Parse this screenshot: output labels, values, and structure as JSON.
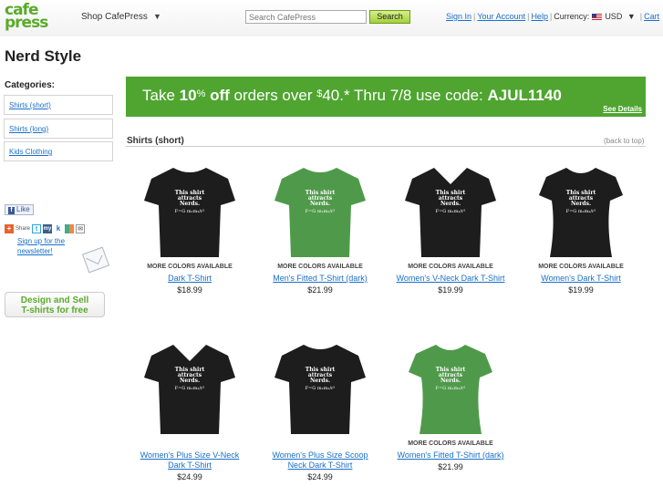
{
  "header": {
    "logo_line1": "cafe",
    "logo_line2": "press",
    "shop_label": "Shop CafePress",
    "search_placeholder": "Search CafePress",
    "search_button": "Search",
    "sign_in": "Sign In",
    "account": "Your Account",
    "help": "Help",
    "currency_label": "Currency:",
    "currency_value": "USD",
    "cart": "Cart"
  },
  "page_title": "Nerd Style",
  "sidebar": {
    "categories_title": "Categories:",
    "categories": [
      "Shirts (short)",
      "Shirts (long)",
      "Kids Clothing"
    ],
    "like": "Like",
    "share": "Share",
    "newsletter": "Sign up for the newsletter!",
    "design_line1": "Design and Sell",
    "design_line2": "T-shirts for free"
  },
  "promo": {
    "take": "Take ",
    "percent": "10",
    "pct_sign": "%",
    "off": " off",
    "orders_over": " orders over ",
    "dollar": "$",
    "amount": "40.",
    "rest": "* Thru 7/8 use code: ",
    "code": "AJUL1140",
    "details": "See Details"
  },
  "section": {
    "title": "Shirts (short)",
    "back_to_top": "(back to top)"
  },
  "shirt_print": [
    "This shirt",
    "attracts",
    "Nerds.",
    "F=G m₁m₂/r²"
  ],
  "colors": {
    "dark": "#1d1d1d",
    "green": "#4f9a4a",
    "accent": "#4fa530",
    "link": "#1a6fc9"
  },
  "products": [
    {
      "more": "MORE COLORS AVAILABLE",
      "name": "Dark T-Shirt",
      "price": "$18.99",
      "style": "crew",
      "color": "dark"
    },
    {
      "more": "MORE COLORS AVAILABLE",
      "name": "Men's Fitted T-Shirt (dark)",
      "price": "$21.99",
      "style": "crew",
      "color": "green"
    },
    {
      "more": "MORE COLORS AVAILABLE",
      "name": "Women's V-Neck Dark T-Shirt",
      "price": "$19.99",
      "style": "vneck",
      "color": "dark"
    },
    {
      "more": "MORE COLORS AVAILABLE",
      "name": "Women's Dark T-Shirt",
      "price": "$19.99",
      "style": "women",
      "color": "dark"
    },
    {
      "more": "",
      "name": "Women's Plus Size V-Neck Dark T-Shirt",
      "price": "$24.99",
      "style": "vneck",
      "color": "dark"
    },
    {
      "more": "",
      "name": "Women's Plus Size Scoop Neck Dark T-Shirt",
      "price": "$24.99",
      "style": "crew",
      "color": "dark"
    },
    {
      "more": "MORE COLORS AVAILABLE",
      "name": "Women's Fitted T-Shirt (dark)",
      "price": "$21.99",
      "style": "women",
      "color": "green"
    }
  ]
}
